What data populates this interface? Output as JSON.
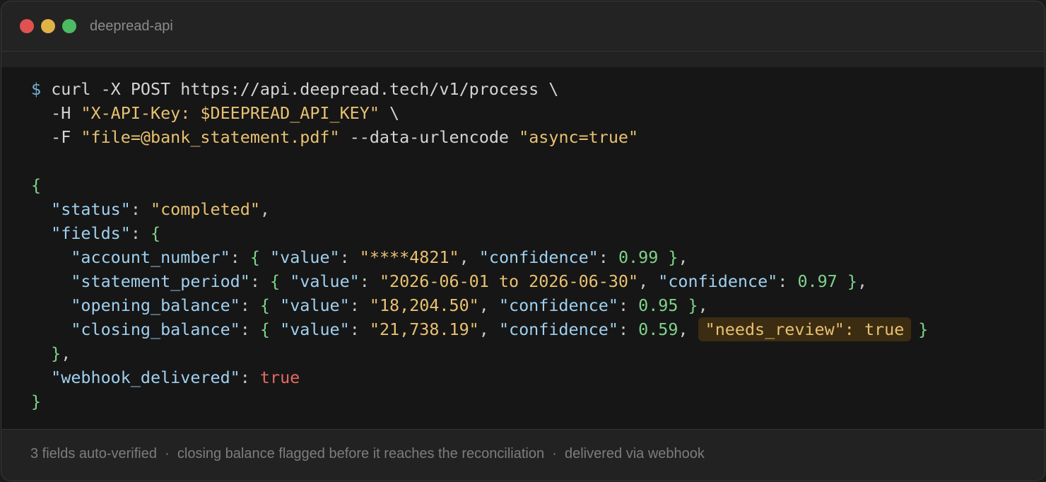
{
  "window": {
    "title": "deepread-api",
    "controls": [
      "close",
      "minimize",
      "maximize"
    ],
    "colors": {
      "close": "#e0524f",
      "minimize": "#e0b347",
      "maximize": "#4dbb63"
    }
  },
  "command": {
    "prompt": "$",
    "line1": "curl -X POST https://api.deepread.tech/v1/process \\",
    "line2_flag": "-H",
    "line2_header": "\"X-API-Key: $DEEPREAD_API_KEY\"",
    "line2_cont": "\\",
    "line3_flag": "-F",
    "line3_file": "\"file=@bank_statement.pdf\"",
    "line3_opt": "--data-urlencode",
    "line3_async": "\"async=true\""
  },
  "response": {
    "status_key": "\"status\"",
    "status_value": "\"completed\"",
    "fields_key": "\"fields\"",
    "value_key": "\"value\"",
    "confidence_key": "\"confidence\"",
    "fields": [
      {
        "name": "\"account_number\"",
        "value": "\"****4821\"",
        "confidence": "0.99"
      },
      {
        "name": "\"statement_period\"",
        "value": "\"2026-06-01 to 2026-06-30\"",
        "confidence": "0.97"
      },
      {
        "name": "\"opening_balance\"",
        "value": "\"18,204.50\"",
        "confidence": "0.95"
      },
      {
        "name": "\"closing_balance\"",
        "value": "\"21,738.19\"",
        "confidence": "0.59",
        "flag": "\"needs_review\": true"
      }
    ],
    "webhook_key": "\"webhook_delivered\"",
    "webhook_value": "true"
  },
  "footer": {
    "text": "3 fields auto-verified  ·  closing balance flagged before it reaches the reconciliation  ·  delivered via webhook"
  }
}
